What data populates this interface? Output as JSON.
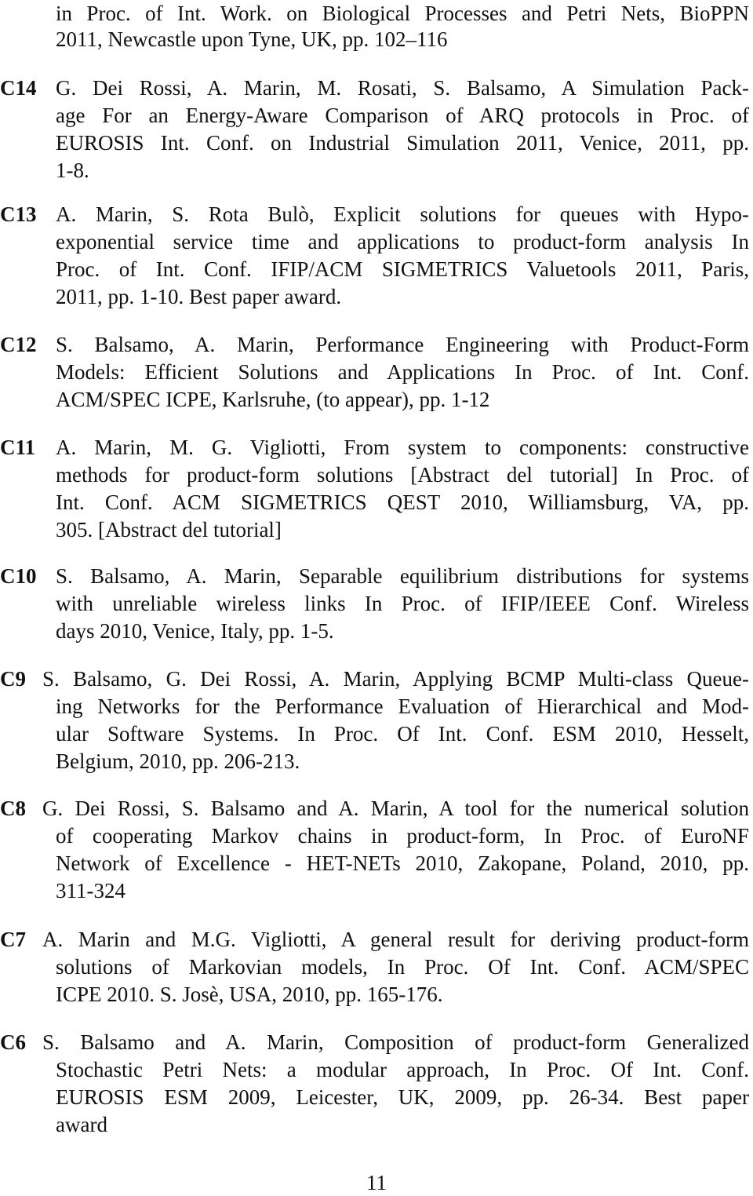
{
  "continuation": {
    "lines": [
      "in Proc. of Int. Work. on Biological Processes and Petri Nets, BioPPN",
      "2011, Newcastle upon Tyne, UK, pp. 102–116"
    ]
  },
  "entries": [
    {
      "label": "C14",
      "lines": [
        "G. Dei Rossi, A. Marin, M. Rosati, S. Balsamo, A Simulation Pack-",
        "age For an Energy-Aware Comparison of ARQ protocols in Proc. of",
        "EUROSIS Int. Conf. on Industrial Simulation 2011, Venice, 2011, pp.",
        "1-8."
      ]
    },
    {
      "label": "C13",
      "lines": [
        "A. Marin, S. Rota Bulò, Explicit solutions for queues with Hypo-",
        "exponential service time and applications to product-form analysis In",
        "Proc. of Int. Conf. IFIP/ACM SIGMETRICS Valuetools 2011, Paris,",
        "2011, pp. 1-10. Best paper award."
      ]
    },
    {
      "label": "C12",
      "lines": [
        "S. Balsamo, A. Marin, Performance Engineering with Product-Form",
        "Models: Efficient Solutions and Applications In Proc. of Int. Conf.",
        "ACM/SPEC ICPE, Karlsruhe, (to appear), pp. 1-12"
      ]
    },
    {
      "label": "C11",
      "lines": [
        "A. Marin, M. G. Vigliotti, From system to components: constructive",
        "methods for product-form solutions [Abstract del tutorial] In Proc. of",
        "Int. Conf. ACM SIGMETRICS QEST 2010, Williamsburg, VA, pp.",
        "305. [Abstract del tutorial]"
      ]
    },
    {
      "label": "C10",
      "lines": [
        "S. Balsamo, A. Marin, Separable equilibrium distributions for systems",
        "with unreliable wireless links In Proc. of IFIP/IEEE Conf. Wireless",
        "days 2010, Venice, Italy, pp. 1-5."
      ]
    },
    {
      "label": "C9",
      "lines": [
        "S. Balsamo, G. Dei Rossi, A. Marin, Applying BCMP Multi-class Queue-",
        "ing Networks for the Performance Evaluation of Hierarchical and Mod-",
        "ular Software Systems. In Proc. Of Int. Conf. ESM 2010, Hesselt,",
        "Belgium, 2010, pp. 206-213."
      ]
    },
    {
      "label": "C8",
      "lines": [
        "G. Dei Rossi, S. Balsamo and A. Marin, A tool for the numerical solution",
        "of cooperating Markov chains in product-form, In Proc. of EuroNF",
        "Network of Excellence - HET-NETs 2010, Zakopane, Poland, 2010, pp.",
        "311-324"
      ]
    },
    {
      "label": "C7",
      "lines": [
        "A. Marin and M.G. Vigliotti, A general result for deriving product-form",
        "solutions of Markovian models, In Proc. Of Int. Conf. ACM/SPEC",
        "ICPE 2010. S. Josè, USA, 2010, pp. 165-176."
      ]
    },
    {
      "label": "C6",
      "lines": [
        "S. Balsamo and A. Marin, Composition of product-form Generalized",
        "Stochastic Petri Nets: a modular approach, In Proc. Of Int. Conf.",
        "EUROSIS ESM 2009, Leicester, UK, 2009, pp. 26-34. Best paper",
        "award"
      ]
    }
  ],
  "footer": {
    "page_number": "11"
  }
}
